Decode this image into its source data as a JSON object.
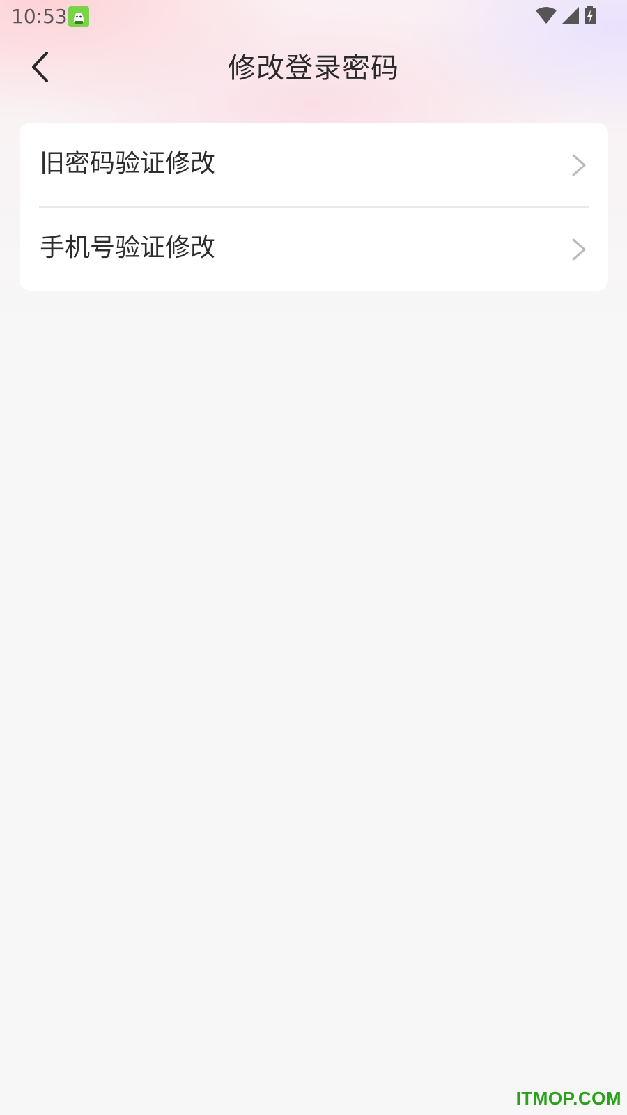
{
  "status_bar": {
    "time": "10:53",
    "icons": [
      "app-notification-icon",
      "wifi-icon",
      "signal-icon",
      "battery-charging-icon"
    ]
  },
  "nav": {
    "title": "修改登录密码",
    "back_icon": "chevron-left-icon"
  },
  "options": [
    {
      "label": "旧密码验证修改",
      "icon": "chevron-right-icon"
    },
    {
      "label": "手机号验证修改",
      "icon": "chevron-right-icon"
    }
  ],
  "watermark": "ITMOP.COM",
  "colors": {
    "page_background": "#f7f7f7",
    "card_background": "#ffffff",
    "watermark": "#2aa11b",
    "arrow": "#b8b8b8"
  }
}
